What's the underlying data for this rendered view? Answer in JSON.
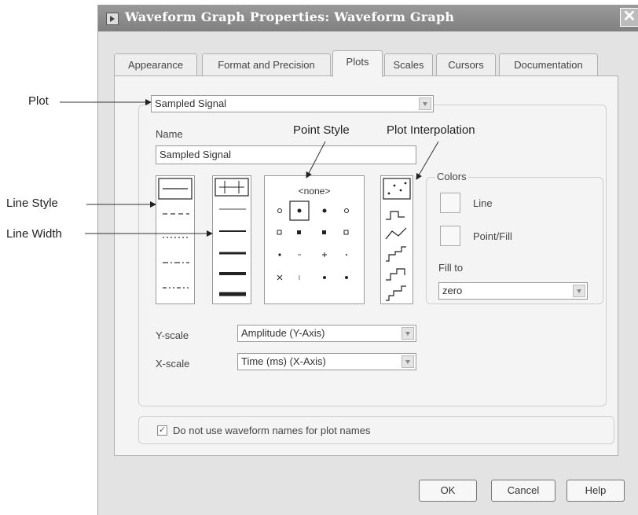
{
  "annotations": {
    "plot": "Plot",
    "point_style": "Point Style",
    "plot_interpolation": "Plot Interpolation",
    "line_style": "Line Style",
    "line_width": "Line Width"
  },
  "window": {
    "title": "Waveform Graph Properties: Waveform Graph",
    "close_glyph": "✕"
  },
  "tabs": [
    {
      "label": "Appearance",
      "active": false
    },
    {
      "label": "Format and Precision",
      "active": false
    },
    {
      "label": "Plots",
      "active": true
    },
    {
      "label": "Scales",
      "active": false
    },
    {
      "label": "Cursors",
      "active": false
    },
    {
      "label": "Documentation",
      "active": false
    }
  ],
  "plots": {
    "plot_select": "Sampled Signal",
    "name_label": "Name",
    "name_value": "Sampled Signal",
    "point_style_none": "<none>",
    "colors_label": "Colors",
    "line_color_label": "Line",
    "point_fill_label": "Point/Fill",
    "fill_to_label": "Fill to",
    "fill_to_value": "zero",
    "y_scale_label": "Y-scale",
    "y_scale_value": "Amplitude (Y-Axis)",
    "x_scale_label": "X-scale",
    "x_scale_value": "Time (ms) (X-Axis)",
    "waveform_names_checkbox": "Do not use waveform names for plot names",
    "waveform_names_checked": true
  },
  "buttons": {
    "ok": "OK",
    "cancel": "Cancel",
    "help": "Help"
  },
  "colors": {
    "titlebar": "#8a8a8a",
    "dialog_bg": "#e3e3e3",
    "panel_bg": "#f4f4f4"
  }
}
